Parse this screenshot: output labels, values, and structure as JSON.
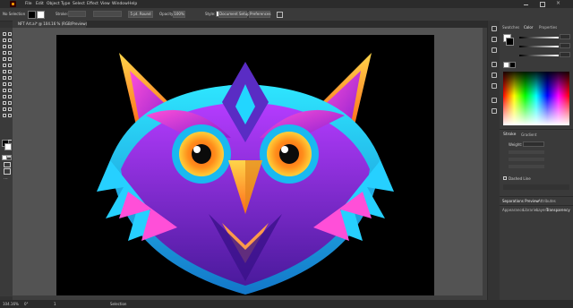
{
  "menubar": {
    "items": [
      "File",
      "Edit",
      "Object",
      "Type",
      "Select",
      "Effect",
      "View",
      "Window",
      "Help"
    ]
  },
  "control_bar": {
    "selection_label": "No Selection",
    "stroke_label": "Stroke:",
    "brush_value": "5 pt. Round",
    "opacity_label": "Opacity:",
    "opacity_value": "100%",
    "style_label": "Style:",
    "document_setup": "Document Setup",
    "preferences": "Preferences"
  },
  "document_tab": {
    "title": "NFT Art.ai* @ 104.16 % (RGB/Preview)"
  },
  "right_panel": {
    "tabs_top": [
      "Swatches",
      "Color",
      "Properties"
    ],
    "active_top_tab": "Color",
    "stroke_tabs": [
      "Stroke",
      "Gradient"
    ],
    "weight_label": "Weight:",
    "dashed_line_label": "Dashed Line",
    "bottom_tabs_1": [
      "Separations Preview",
      "Attributes"
    ],
    "bottom_tabs_2": [
      "Appearance",
      "Libraries",
      "Layers",
      "Transparency"
    ],
    "active_bottom_tab": "Transparency"
  },
  "status_bar": {
    "zoom": "104.16%",
    "rotation": "0°",
    "artboard": "1",
    "tool": "Selection"
  },
  "colors": {
    "accent": "#ff9a00",
    "canvas_bg": "#535353",
    "artboard": "#000000"
  }
}
